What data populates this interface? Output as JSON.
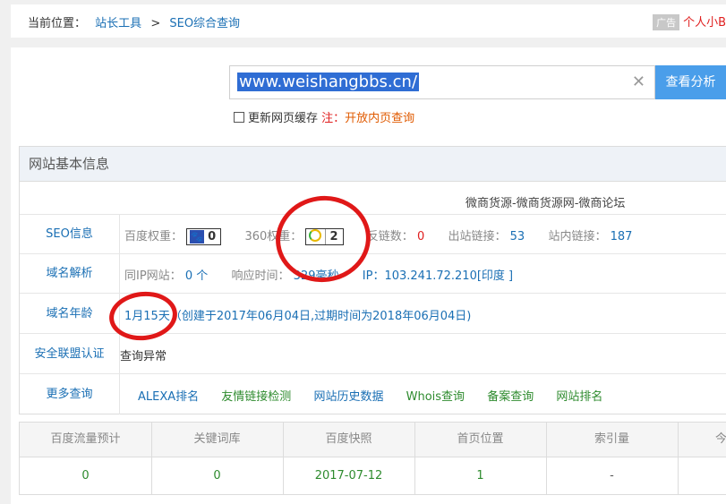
{
  "breadcrumb": {
    "prefix": "当前位置：",
    "item1": "站长工具",
    "sep": ">",
    "item2": "SEO综合查询"
  },
  "ad": {
    "tag": "广告",
    "text": "个人小B"
  },
  "search": {
    "value": "www.weishangbbs.cn/",
    "clear": "✕",
    "button": "查看分析"
  },
  "cache": {
    "label": "更新网页缓存",
    "note_label": "注：",
    "note_text": "开放内页查询"
  },
  "info": {
    "heading": "网站基本信息",
    "site_title": "微商货源-微商货源网-微商论坛",
    "seo": {
      "label": "SEO信息",
      "baidu_label": "百度权重：",
      "baidu_value": "0",
      "w360_label": "360权重：",
      "w360_value": "2",
      "backlink_label": "反链数：",
      "backlink_value": "0",
      "outlink_label": "出站链接：",
      "outlink_value": "53",
      "inlink_label": "站内链接：",
      "inlink_value": "187"
    },
    "dns": {
      "label": "域名解析",
      "sameip_label": "同IP网站：",
      "sameip_value": "0 个",
      "resp_label": "响应时间：",
      "resp_value": "329毫秒",
      "ip_label": "IP：",
      "ip_value": "103.241.72.210[印度 ]"
    },
    "age": {
      "label": "域名年龄",
      "value": "1月15天",
      "detail": "（创建于2017年06月04日,过期时间为2018年06月04日)"
    },
    "security": {
      "label": "安全联盟认证",
      "value": "查询异常"
    },
    "more": {
      "label": "更多查询",
      "links": [
        "ALEXA排名",
        "友情链接检测",
        "网站历史数据",
        "Whois查询",
        "备案查询",
        "网站排名"
      ]
    }
  },
  "stats": {
    "headers": [
      "百度流量预计",
      "关键词库",
      "百度快照",
      "首页位置",
      "索引量",
      "今"
    ],
    "values": [
      "0",
      "0",
      "2017-07-12",
      "1",
      "-",
      ""
    ]
  },
  "colors": {
    "accent": "#4a9eea",
    "link": "#1a6fb4",
    "green": "#2e8b2e",
    "red": "#e02020",
    "annotation": "#e01818"
  }
}
